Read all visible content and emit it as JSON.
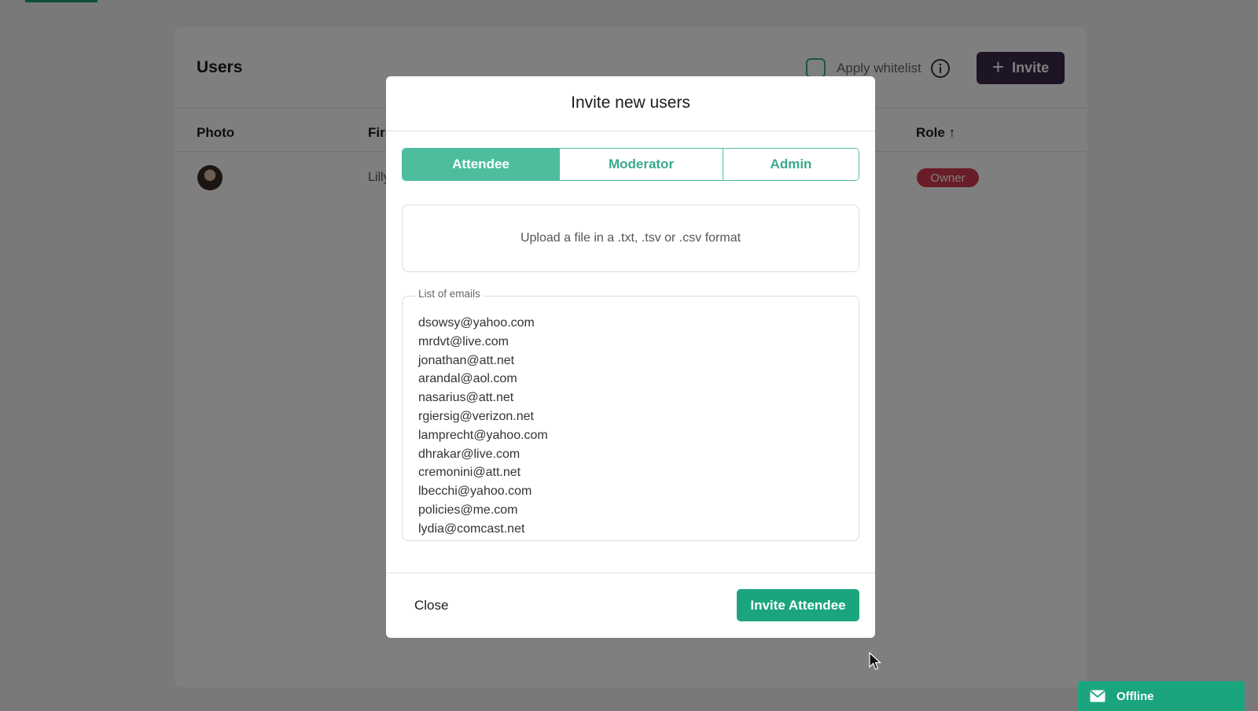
{
  "users_page": {
    "title": "Users",
    "whitelist_label": "Apply whitelist",
    "invite_label": "Invite",
    "columns": {
      "photo": "Photo",
      "first": "Firs",
      "role": "Role"
    },
    "row": {
      "first": "Lilly",
      "role_badge": "Owner"
    }
  },
  "modal": {
    "title": "Invite new users",
    "tabs": [
      {
        "label": "Attendee",
        "active": true
      },
      {
        "label": "Moderator",
        "active": false
      },
      {
        "label": "Admin",
        "active": false
      }
    ],
    "upload_hint": "Upload a file in a .txt, .tsv or .csv format",
    "emails_label": "List of emails",
    "emails": [
      "dsowsy@yahoo.com",
      "mrdvt@live.com",
      "jonathan@att.net",
      "arandal@aol.com",
      "nasarius@att.net",
      "rgiersig@verizon.net",
      "lamprecht@yahoo.com",
      "dhrakar@live.com",
      "cremonini@att.net",
      "lbecchi@yahoo.com",
      "policies@me.com",
      "lydia@comcast.net"
    ],
    "close_label": "Close",
    "submit_label": "Invite Attendee"
  },
  "status_chip": {
    "label": "Offline",
    "icon": "envelope-icon"
  },
  "colors": {
    "accent": "#4dbd9e",
    "primary_green": "#1ba57f",
    "dark_button": "#3b2a4a",
    "owner_badge": "#d23a4e"
  }
}
